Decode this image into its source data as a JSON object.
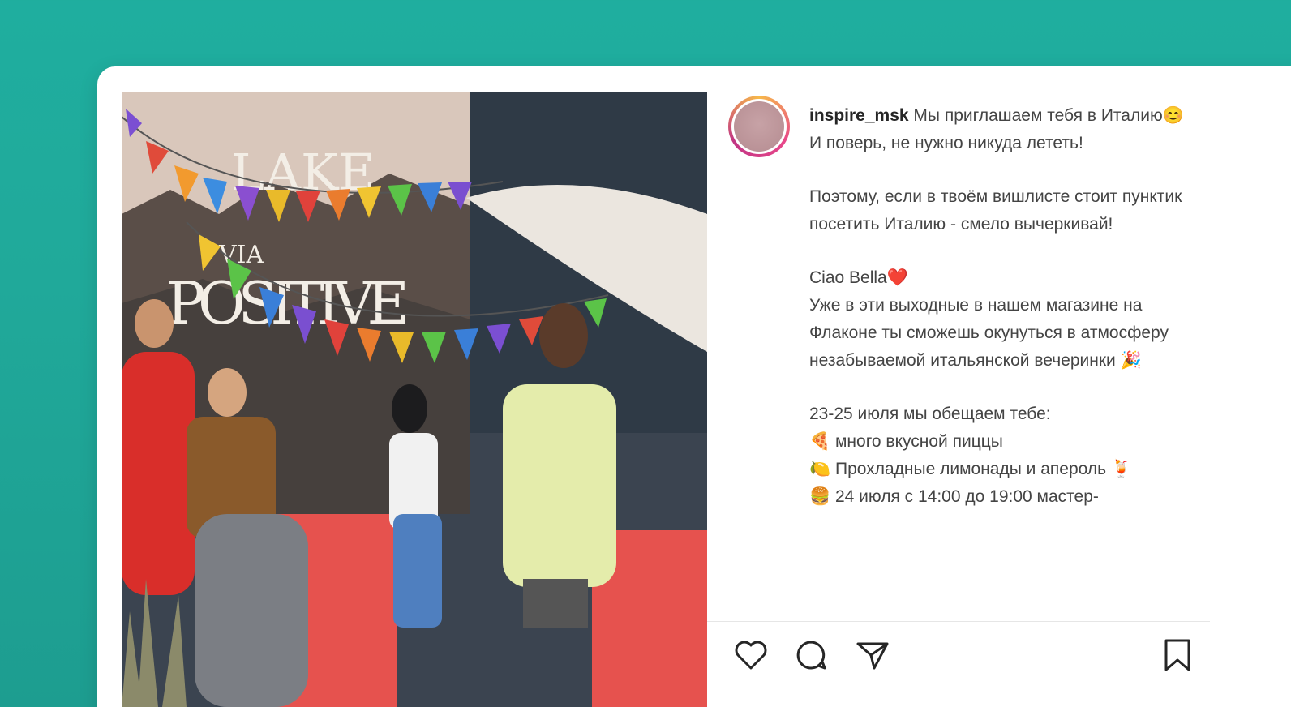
{
  "post": {
    "username": "inspire_msk",
    "caption": {
      "intro": "Мы приглашаем тебя в Италию😊 И поверь, не нужно никуда лететь!",
      "para2": "Поэтому, если в твоём вишлисте стоит пунктик посетить Италию - смело вычеркивай!",
      "greeting": "Ciao Bella❤️",
      "para3": "Уже в эти выходные в нашем магазине на Флаконе ты сможешь окунуться в атмосферу незабываемой итальянской вечеринки 🎉",
      "dates": "23-25 июля мы обещаем тебе:",
      "item1": "🍕 много вкусной пиццы",
      "item2": "🍋 Прохладные лимонады и апероль 🍹",
      "item3": "🍔 24 июля с 14:00 до 19:00 мастер-"
    },
    "photo_text": {
      "line1": "LAKE",
      "line2": "VIA",
      "line3": "POSITIVE"
    }
  },
  "colors": {
    "background": "#1fae9f",
    "card": "#ffffff",
    "heart_accent": "#e0245e"
  },
  "icons": {
    "like": "heart-icon",
    "comment": "comment-icon",
    "share": "send-icon",
    "save": "bookmark-icon",
    "next": "chevron-right-icon"
  }
}
